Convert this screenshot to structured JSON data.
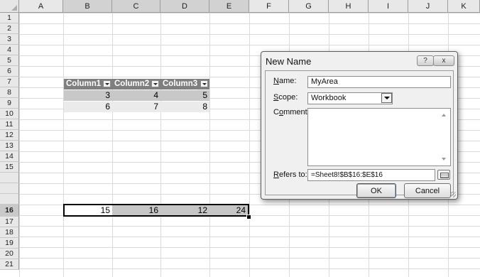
{
  "columns": [
    "A",
    "B",
    "C",
    "D",
    "E",
    "F",
    "G",
    "H",
    "I",
    "J",
    "K"
  ],
  "rows": [
    "1",
    "2",
    "3",
    "4",
    "5",
    "6",
    "7",
    "8",
    "9",
    "10",
    "11",
    "12",
    "13",
    "14",
    "15",
    "16",
    "17",
    "18",
    "19",
    "20",
    "21"
  ],
  "table": {
    "headers": [
      "Column1",
      "Column2",
      "Column3"
    ],
    "row7": [
      "3",
      "4",
      "5"
    ],
    "row8": [
      "6",
      "7",
      "8"
    ]
  },
  "row16": [
    "15",
    "16",
    "12",
    "24"
  ],
  "dialog": {
    "title": "New Name",
    "help": "?",
    "close": "x",
    "name_label": "Name:",
    "name_value": "MyArea",
    "scope_label": "Scope:",
    "scope_value": "Workbook",
    "comment_label": "Comment:",
    "refers_label": "Refers to:",
    "refers_value": "=Sheet8!$B$16:$E$16",
    "ok": "OK",
    "cancel": "Cancel"
  }
}
